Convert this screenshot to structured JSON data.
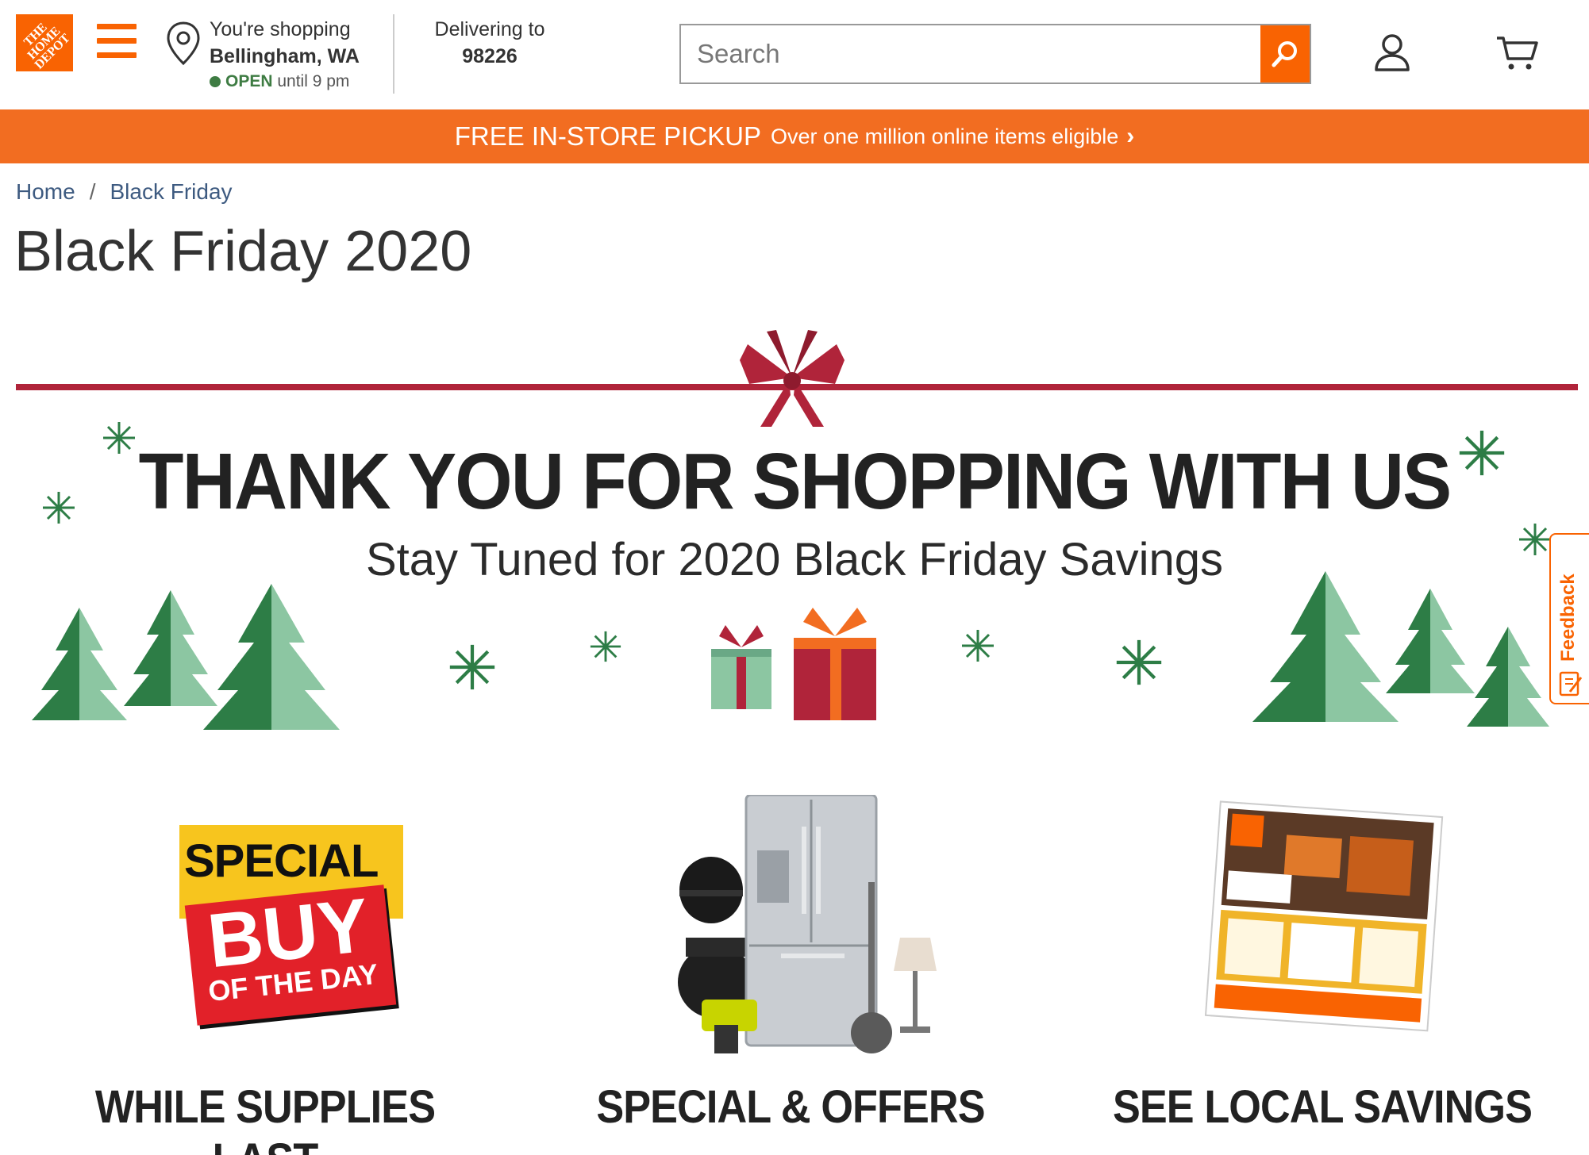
{
  "header": {
    "logo_text": "THE\nHOME\nDEPOT",
    "store_line1": "You're shopping",
    "store_city": "Bellingham, WA",
    "store_status": "OPEN",
    "store_hours": "until 9 pm",
    "deliver_label": "Delivering to",
    "deliver_zip": "98226",
    "search_placeholder": "Search"
  },
  "promo": {
    "headline": "FREE IN-STORE PICKUP",
    "detail": "Over one million online items eligible",
    "chevron": "›"
  },
  "breadcrumb": {
    "home": "Home",
    "separator": "/",
    "current": "Black Friday"
  },
  "page_title": "Black Friday 2020",
  "hero": {
    "headline": "THANK YOU FOR SHOPPING WITH US",
    "subhead": "Stay Tuned for 2020 Black Friday Savings"
  },
  "feedback_label": "Feedback",
  "cards": [
    {
      "label": "WHILE SUPPLIES LAST",
      "badge_top": "SPECIAL",
      "badge_mid": "BUY",
      "badge_bottom": "OF THE DAY"
    },
    {
      "label": "SPECIAL & OFFERS"
    },
    {
      "label": "SEE LOCAL SAVINGS"
    }
  ],
  "colors": {
    "brand_orange": "#f96302",
    "banner_orange": "#f26d21",
    "ribbon_red": "#b0243a",
    "tree_dark": "#2d7d46",
    "tree_light": "#8cc6a2",
    "open_green": "#3e7c43"
  }
}
